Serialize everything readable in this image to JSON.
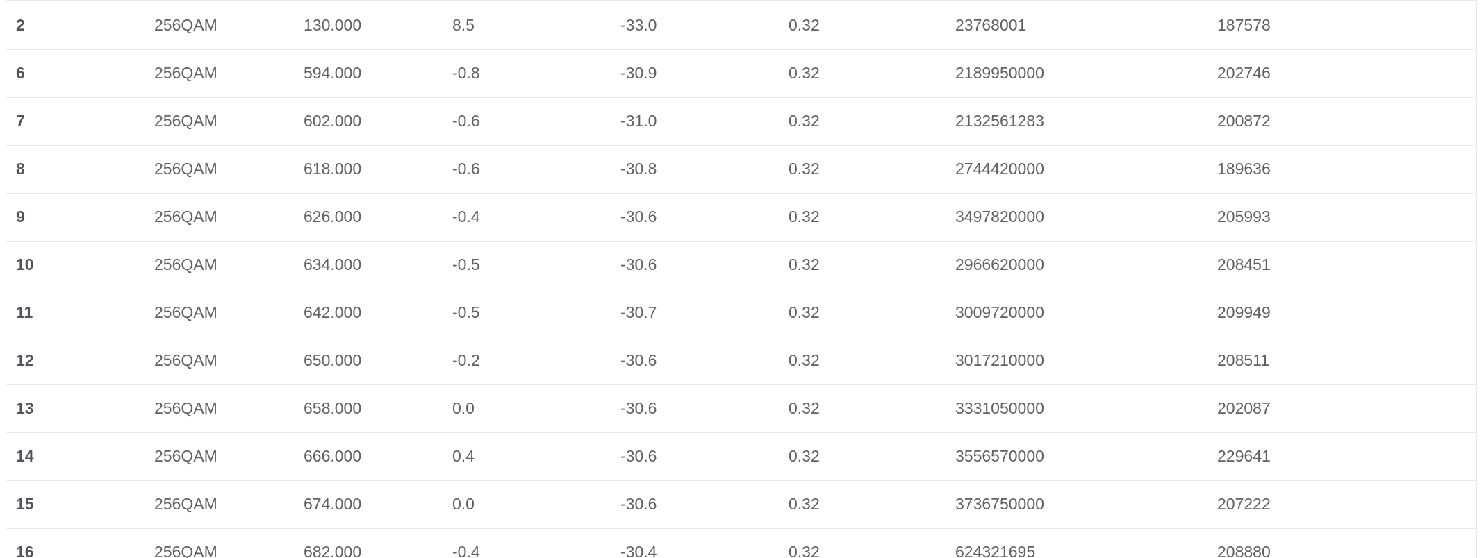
{
  "rows": [
    [
      "2",
      "256QAM",
      "130.000",
      "8.5",
      "-33.0",
      "0.32",
      "23768001",
      "187578"
    ],
    [
      "6",
      "256QAM",
      "594.000",
      "-0.8",
      "-30.9",
      "0.32",
      "2189950000",
      "202746"
    ],
    [
      "7",
      "256QAM",
      "602.000",
      "-0.6",
      "-31.0",
      "0.32",
      "2132561283",
      "200872"
    ],
    [
      "8",
      "256QAM",
      "618.000",
      "-0.6",
      "-30.8",
      "0.32",
      "2744420000",
      "189636"
    ],
    [
      "9",
      "256QAM",
      "626.000",
      "-0.4",
      "-30.6",
      "0.32",
      "3497820000",
      "205993"
    ],
    [
      "10",
      "256QAM",
      "634.000",
      "-0.5",
      "-30.6",
      "0.32",
      "2966620000",
      "208451"
    ],
    [
      "11",
      "256QAM",
      "642.000",
      "-0.5",
      "-30.7",
      "0.32",
      "3009720000",
      "209949"
    ],
    [
      "12",
      "256QAM",
      "650.000",
      "-0.2",
      "-30.6",
      "0.32",
      "3017210000",
      "208511"
    ],
    [
      "13",
      "256QAM",
      "658.000",
      "0.0",
      "-30.6",
      "0.32",
      "3331050000",
      "202087"
    ],
    [
      "14",
      "256QAM",
      "666.000",
      "0.4",
      "-30.6",
      "0.32",
      "3556570000",
      "229641"
    ],
    [
      "15",
      "256QAM",
      "674.000",
      "0.0",
      "-30.6",
      "0.32",
      "3736750000",
      "207222"
    ],
    [
      "16",
      "256QAM",
      "682.000",
      "-0.4",
      "-30.4",
      "0.32",
      "624321695",
      "208880"
    ]
  ]
}
